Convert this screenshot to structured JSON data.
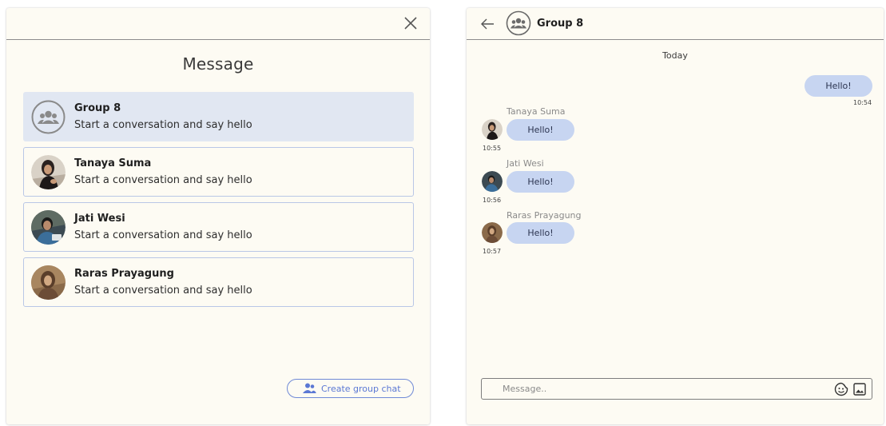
{
  "left_panel": {
    "title": "Message",
    "conversations": [
      {
        "name": "Group 8",
        "preview": "Start a conversation and say hello",
        "avatar": "group-icon"
      },
      {
        "name": "Tanaya Suma",
        "preview": "Start a conversation and say hello",
        "avatar": "photo"
      },
      {
        "name": "Jati Wesi",
        "preview": "Start a conversation and say hello",
        "avatar": "photo"
      },
      {
        "name": "Raras Prayagung",
        "preview": "Start a conversation and say hello",
        "avatar": "photo"
      }
    ],
    "create_group_label": "Create group chat",
    "icons": [
      "close-icon",
      "group-add-icon"
    ]
  },
  "right_panel": {
    "title": "Group 8",
    "day_label": "Today",
    "messages": [
      {
        "sender": "me",
        "text": "Hello!",
        "time": "10:54"
      },
      {
        "sender": "Tanaya Suma",
        "text": "Hello!",
        "time": "10:55"
      },
      {
        "sender": "Jati Wesi",
        "text": "Hello!",
        "time": "10:56"
      },
      {
        "sender": "Raras Prayagung",
        "text": "Hello!",
        "time": "10:57"
      }
    ],
    "composer": {
      "placeholder": "Message..",
      "value": ""
    },
    "icons": [
      "back-arrow-icon",
      "group-icon",
      "emoji-icon",
      "image-icon"
    ]
  },
  "colors": {
    "panel_bg": "#fdfbf3",
    "active_item_bg": "#e1e7f2",
    "item_border": "#b9c7e6",
    "bubble_bg": "#c7d5f1",
    "accent": "#5b78d4"
  }
}
